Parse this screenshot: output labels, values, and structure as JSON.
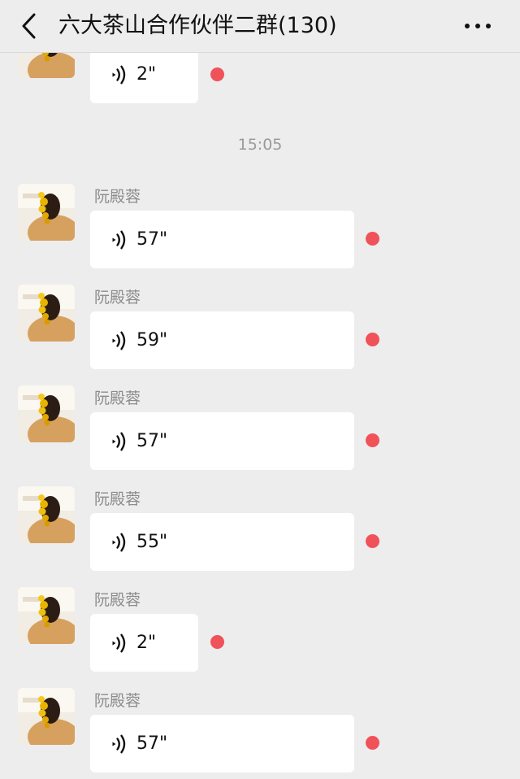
{
  "header": {
    "title": "六大茶山合作伙伴二群(130)",
    "back_icon": "chevron-left-icon",
    "more_icon": "more-dots-icon"
  },
  "chat": {
    "timestamp": "15:05",
    "top_message": {
      "duration": "2\"",
      "unread": true
    },
    "messages": [
      {
        "sender": "阮殿蓉",
        "duration": "57\"",
        "unread": true
      },
      {
        "sender": "阮殿蓉",
        "duration": "59\"",
        "unread": true
      },
      {
        "sender": "阮殿蓉",
        "duration": "57\"",
        "unread": true
      },
      {
        "sender": "阮殿蓉",
        "duration": "55\"",
        "unread": true
      },
      {
        "sender": "阮殿蓉",
        "duration": "2\"",
        "unread": true
      },
      {
        "sender": "阮殿蓉",
        "duration": "57\"",
        "unread": true
      }
    ]
  },
  "colors": {
    "background": "#ededed",
    "bubble": "#ffffff",
    "unread_dot": "#f0525a",
    "meta_text": "#9a9a9a"
  }
}
